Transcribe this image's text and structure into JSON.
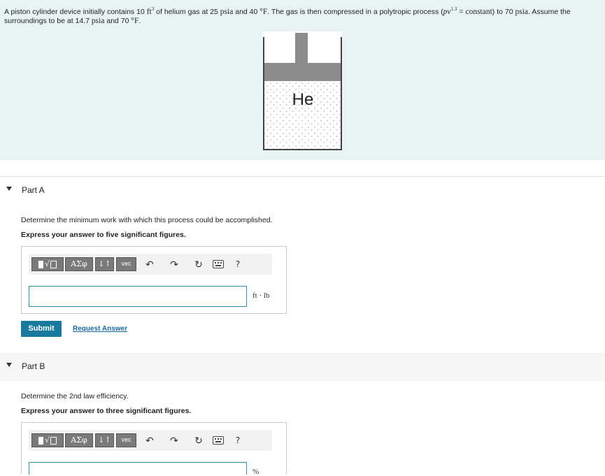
{
  "problem": {
    "text_1": "A piston cylinder device initially contains 10 ",
    "unit_ft3": "ft",
    "exp_3": "3",
    "text_2": " of helium gas at 25 ",
    "unit_psia": "psia",
    "text_3": " and 40 ",
    "unit_degF": "°F",
    "text_4": ". The gas is then compressed in a polytropic process (",
    "math_pv": "pv",
    "exp_13": "1.3",
    "math_constant": " = constant",
    "text_5": ") to 70 ",
    "unit_psia2": "psia",
    "text_6": ". Assume the surroundings to be at 14.7 ",
    "unit_psia3": "psia",
    "text_7": " and 70 ",
    "unit_degF2": "°F",
    "text_8": ".",
    "figure_label": "He"
  },
  "toolbar": {
    "templates_label": "√",
    "greek_label": "ΑΣφ",
    "arrows_label": "↓↑",
    "vec_label": "vec",
    "help_label": "?"
  },
  "part_a": {
    "title": "Part A",
    "prompt": "Determine the minimum work with which this process could be accomplished.",
    "instruction": "Express your answer to five significant figures.",
    "input_value": "",
    "unit": "ft · lb",
    "submit_label": "Submit",
    "request_label": "Request Answer"
  },
  "part_b": {
    "title": "Part B",
    "prompt": "Determine the 2nd law efficiency.",
    "instruction": "Express your answer to three significant figures.",
    "input_value": "",
    "unit": "%"
  },
  "colors": {
    "problem_bg": "#e8f4f4",
    "submit_bg": "#1a7a9e",
    "input_border": "#3a8ba8",
    "link": "#1a6aa0"
  }
}
